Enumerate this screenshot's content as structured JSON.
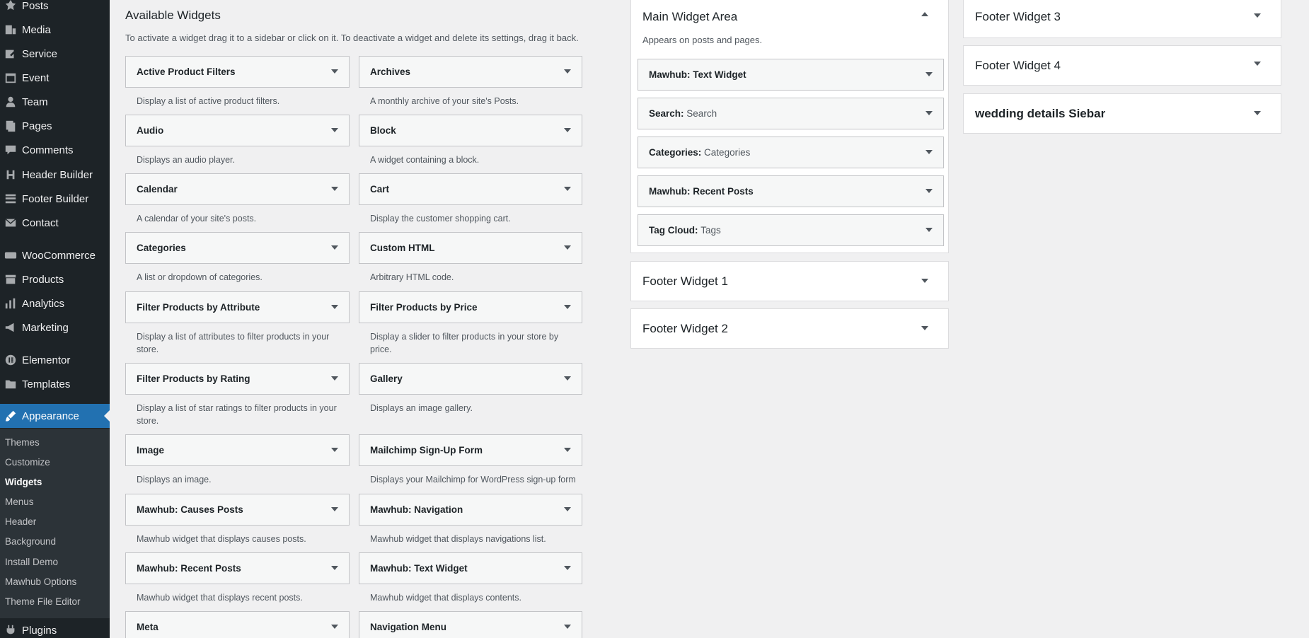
{
  "sidebar": {
    "items": [
      {
        "label": "Posts",
        "icon": "pin-icon"
      },
      {
        "label": "Media",
        "icon": "media-icon"
      },
      {
        "label": "Service",
        "icon": "edit-icon"
      },
      {
        "label": "Event",
        "icon": "calendar-icon"
      },
      {
        "label": "Team",
        "icon": "person-icon"
      },
      {
        "label": "Pages",
        "icon": "pages-icon"
      },
      {
        "label": "Comments",
        "icon": "comment-icon"
      },
      {
        "label": "Header Builder",
        "icon": "h-icon"
      },
      {
        "label": "Footer Builder",
        "icon": "footer-icon"
      },
      {
        "label": "Contact",
        "icon": "mail-icon"
      },
      {
        "label": "WooCommerce",
        "icon": "woo-icon"
      },
      {
        "label": "Products",
        "icon": "archive-icon"
      },
      {
        "label": "Analytics",
        "icon": "bar-chart-icon"
      },
      {
        "label": "Marketing",
        "icon": "megaphone-icon"
      },
      {
        "label": "Elementor",
        "icon": "elementor-icon"
      },
      {
        "label": "Templates",
        "icon": "folder-icon"
      },
      {
        "label": "Appearance",
        "icon": "brush-icon"
      },
      {
        "label": "Plugins",
        "icon": "plug-icon"
      }
    ],
    "submenu": [
      "Themes",
      "Customize",
      "Widgets",
      "Menus",
      "Header",
      "Background",
      "Install Demo",
      "Mawhub Options",
      "Theme File Editor"
    ]
  },
  "available": {
    "title": "Available Widgets",
    "description": "To activate a widget drag it to a sidebar or click on it. To deactivate a widget and delete its settings, drag it back.",
    "widgets": [
      {
        "title": "Active Product Filters",
        "desc": "Display a list of active product filters."
      },
      {
        "title": "Archives",
        "desc": "A monthly archive of your site's Posts."
      },
      {
        "title": "Audio",
        "desc": "Displays an audio player."
      },
      {
        "title": "Block",
        "desc": "A widget containing a block."
      },
      {
        "title": "Calendar",
        "desc": "A calendar of your site's posts."
      },
      {
        "title": "Cart",
        "desc": "Display the customer shopping cart."
      },
      {
        "title": "Categories",
        "desc": "A list or dropdown of categories."
      },
      {
        "title": "Custom HTML",
        "desc": "Arbitrary HTML code."
      },
      {
        "title": "Filter Products by Attribute",
        "desc": "Display a list of attributes to filter products in your store."
      },
      {
        "title": "Filter Products by Price",
        "desc": "Display a slider to filter products in your store by price."
      },
      {
        "title": "Filter Products by Rating",
        "desc": "Display a list of star ratings to filter products in your store."
      },
      {
        "title": "Gallery",
        "desc": "Displays an image gallery."
      },
      {
        "title": "Image",
        "desc": "Displays an image."
      },
      {
        "title": "Mailchimp Sign-Up Form",
        "desc": "Displays your Mailchimp for WordPress sign-up form"
      },
      {
        "title": "Mawhub: Causes Posts",
        "desc": "Mawhub widget that displays causes posts."
      },
      {
        "title": "Mawhub: Navigation",
        "desc": "Mawhub widget that displays navigations list."
      },
      {
        "title": "Mawhub: Recent Posts",
        "desc": "Mawhub widget that displays recent posts."
      },
      {
        "title": "Mawhub: Text Widget",
        "desc": "Mawhub widget that displays contents."
      },
      {
        "title": "Meta",
        "desc": ""
      },
      {
        "title": "Navigation Menu",
        "desc": ""
      }
    ]
  },
  "areas": {
    "main": {
      "title": "Main Widget Area",
      "description": "Appears on posts and pages.",
      "widgets": [
        {
          "title": "Mawhub: Text Widget",
          "sub": ""
        },
        {
          "title": "Search:",
          "sub": "Search"
        },
        {
          "title": "Categories:",
          "sub": "Categories"
        },
        {
          "title": "Mawhub: Recent Posts",
          "sub": ""
        },
        {
          "title": "Tag Cloud:",
          "sub": "Tags"
        }
      ]
    },
    "footer1": "Footer Widget 1",
    "footer2": "Footer Widget 2",
    "footer3": "Footer Widget 3",
    "footer4": "Footer Widget 4",
    "wedding": "wedding details Siebar"
  }
}
